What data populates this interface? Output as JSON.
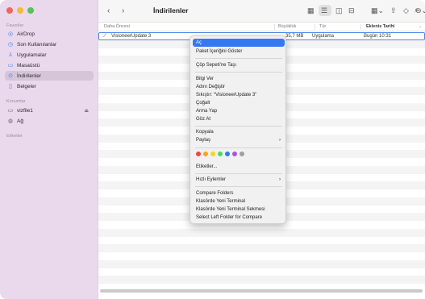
{
  "sidebar": {
    "favorites_label": "Favoriler",
    "favorites": [
      {
        "label": "AirDrop",
        "icon": "airdrop-icon"
      },
      {
        "label": "Son Kullanılanlar",
        "icon": "clock-icon"
      },
      {
        "label": "Uygulamalar",
        "icon": "apps-icon"
      },
      {
        "label": "Masaüstü",
        "icon": "desktop-icon"
      },
      {
        "label": "İndirilenler",
        "icon": "download-icon",
        "selected": true
      },
      {
        "label": "Belgeler",
        "icon": "document-icon"
      }
    ],
    "locations_label": "Konumlar",
    "locations": [
      {
        "label": "vizfile1",
        "icon": "computer-icon"
      },
      {
        "label": "Ağ",
        "icon": "network-icon"
      }
    ],
    "tags_label": "Etiketler"
  },
  "toolbar": {
    "title": "İndirilenler"
  },
  "columns": {
    "name": "Daha Öncesi",
    "size": "Büyüklük",
    "kind": "Tür",
    "date_added": "Eklenis Tarihi"
  },
  "file": {
    "name": "VisioneerUpdate 3",
    "size": "35,7 MB",
    "kind": "Uygulama",
    "date": "Bugün 10:31"
  },
  "menu": {
    "items": [
      "Aç",
      "Paket İçeriğini Göster",
      "Çöp Sepeti'ne Taşı",
      "Bilgi Ver",
      "Adını Değiştir",
      "Sıkıştır: “VisioneerUpdate 3”",
      "Çoğalt",
      "Arma Yap",
      "Göz At",
      "Kopyala",
      "Paylaş",
      "Etiketler...",
      "Hızlı Eylemler",
      "Compare Folders",
      "Klasörde Yeni Terminal",
      "Klasörde Yeni Terminal Sekmesi",
      "Select Left Folder for Compare"
    ],
    "tag_colors": [
      "#f2473f",
      "#f5a623",
      "#f5d423",
      "#4cd964",
      "#3478f6",
      "#a259d9",
      "#a0a0a0"
    ]
  }
}
